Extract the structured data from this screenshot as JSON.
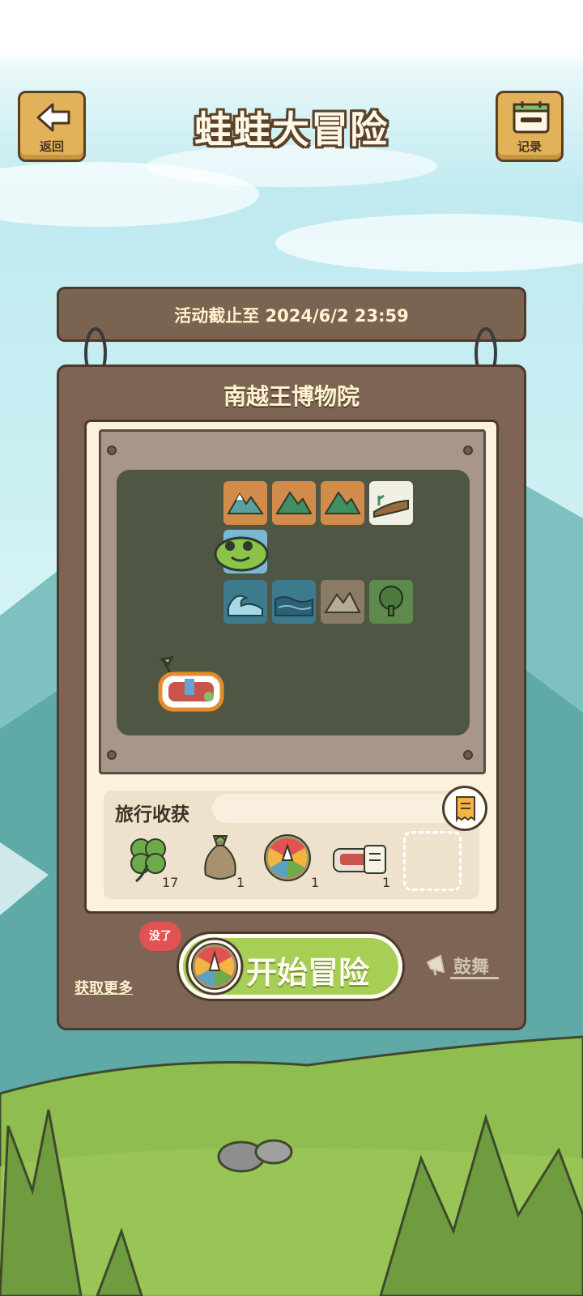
{
  "header": {
    "title": "蛙蛙大冒险",
    "back_label": "返回",
    "record_label": "记录"
  },
  "event": {
    "deadline": "活动截止至 2024/6/2 23:59",
    "location": "南越王博物院"
  },
  "map": {
    "tiles_row1": [
      "snow-mountain-icon",
      "mountain-icon",
      "mountain-icon",
      "cliff-icon"
    ],
    "tiles_row3": [
      "wave-icon",
      "lake-icon",
      "rocky-mountain-icon",
      "tree-icon"
    ]
  },
  "loot": {
    "title": "旅行收获",
    "items": [
      {
        "icon": "clover-icon",
        "count": "17"
      },
      {
        "icon": "money-bag-icon",
        "count": "1"
      },
      {
        "icon": "wheel-ticket-icon",
        "count": "1"
      },
      {
        "icon": "souvenir-ticket-icon",
        "count": "1"
      }
    ]
  },
  "actions": {
    "start_label": "开始冒险",
    "badge_label": "没了",
    "more_label": "获取更多",
    "cheer_label": "鼓舞"
  },
  "colors": {
    "wood": "#7d6454",
    "button_green": "#a8cf55",
    "badge_red": "#e35252",
    "title_outline": "#5b4128"
  }
}
